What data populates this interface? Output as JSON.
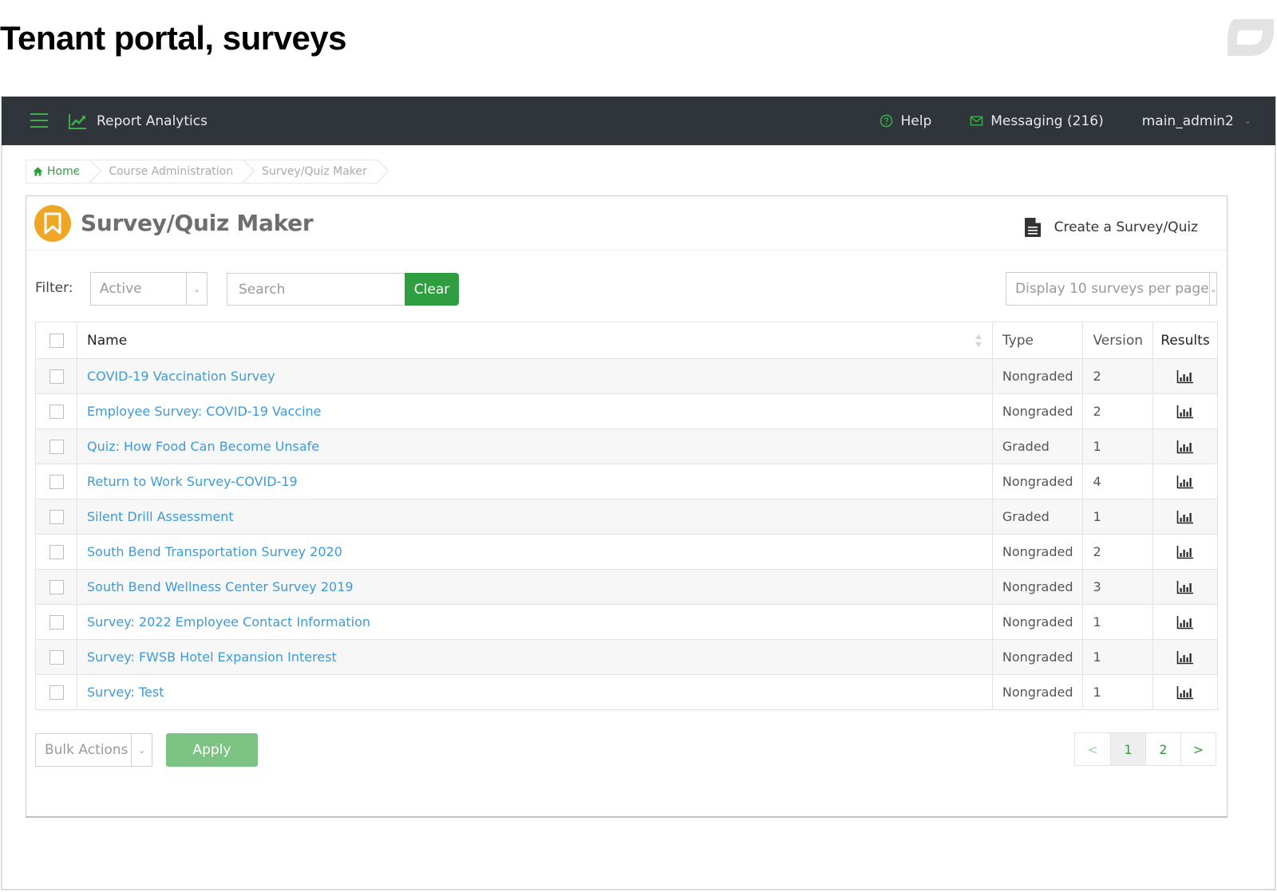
{
  "page_heading": "Tenant portal, surveys",
  "colors": {
    "topbar_bg": "#30343b",
    "accent_green": "#2f9e41",
    "link_blue": "#3d9ad6",
    "panel_icon_orange": "#eea624",
    "apply_disabled_green": "#7cc283"
  },
  "topbar": {
    "menu_icon": "hamburger-icon",
    "app_icon": "line-chart-icon",
    "app_title": "Report Analytics",
    "help_icon": "question-circle-icon",
    "help_label": "Help",
    "messaging_icon": "envelope-icon",
    "messaging_label": "Messaging (216)",
    "user_label": "main_admin2",
    "user_chevron": "chevron-down-icon"
  },
  "breadcrumb": {
    "items": [
      {
        "label": "Home",
        "icon": "home-icon"
      },
      {
        "label": "Course Administration"
      },
      {
        "label": "Survey/Quiz Maker"
      }
    ]
  },
  "panel": {
    "icon": "bookmark-icon",
    "title": "Survey/Quiz Maker",
    "create_icon": "document-icon",
    "create_label": "Create a Survey/Quiz"
  },
  "filters": {
    "filter_label": "Filter:",
    "status_selected": "Active",
    "search_placeholder": "Search",
    "clear_label": "Clear",
    "per_page_selected": "Display 10 surveys per page"
  },
  "table": {
    "columns": [
      "Name",
      "Type",
      "Version",
      "Results"
    ],
    "rows": [
      {
        "name": "COVID-19 Vaccination Survey",
        "type": "Nongraded",
        "version": "2"
      },
      {
        "name": "Employee Survey: COVID-19 Vaccine",
        "type": "Nongraded",
        "version": "2"
      },
      {
        "name": "Quiz: How Food Can Become Unsafe",
        "type": "Graded",
        "version": "1"
      },
      {
        "name": "Return to Work Survey-COVID-19",
        "type": "Nongraded",
        "version": "4"
      },
      {
        "name": "Silent Drill Assessment",
        "type": "Graded",
        "version": "1"
      },
      {
        "name": "South Bend Transportation Survey 2020",
        "type": "Nongraded",
        "version": "2"
      },
      {
        "name": "South Bend Wellness Center Survey 2019",
        "type": "Nongraded",
        "version": "3"
      },
      {
        "name": "Survey: 2022 Employee Contact Information",
        "type": "Nongraded",
        "version": "1"
      },
      {
        "name": "Survey: FWSB Hotel Expansion Interest",
        "type": "Nongraded",
        "version": "1"
      },
      {
        "name": "Survey: Test",
        "type": "Nongraded",
        "version": "1"
      }
    ],
    "results_icon": "bar-chart-icon"
  },
  "footer": {
    "bulk_selected": "Bulk Actions",
    "apply_label": "Apply",
    "pagination": {
      "prev": "<",
      "pages": [
        "1",
        "2"
      ],
      "current": "1",
      "next": ">"
    }
  }
}
